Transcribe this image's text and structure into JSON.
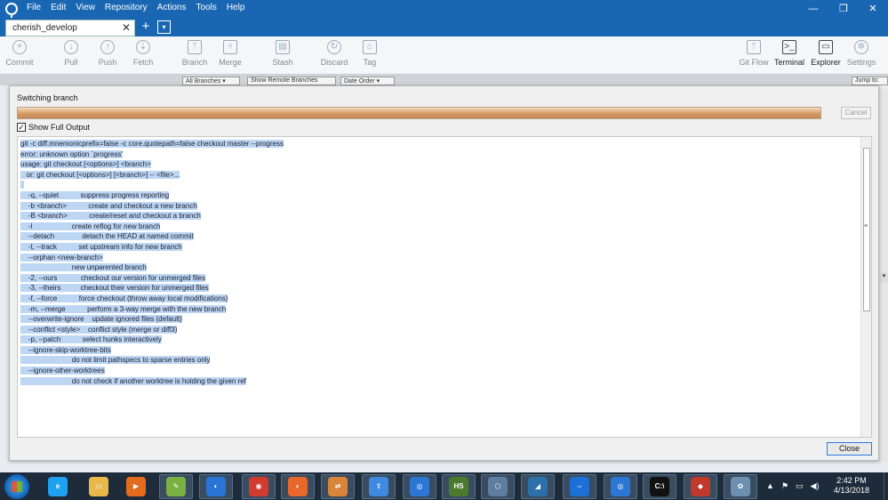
{
  "menu": [
    "File",
    "Edit",
    "View",
    "Repository",
    "Actions",
    "Tools",
    "Help"
  ],
  "window_controls": {
    "minimize": "—",
    "restore": "❐",
    "close": "✕"
  },
  "tab": {
    "label": "cherish_develop",
    "close": "✕",
    "add": "+",
    "dropdown": "▾"
  },
  "toolbar": {
    "commit": "Commit",
    "pull": "Pull",
    "push": "Push",
    "fetch": "Fetch",
    "branch": "Branch",
    "merge": "Merge",
    "stash": "Stash",
    "discard": "Discard",
    "tag": "Tag",
    "gitflow": "Git Flow",
    "terminal": "Terminal",
    "explorer": "Explorer",
    "settings": "Settings"
  },
  "filters": {
    "branches": "All Branches ▾",
    "remote": "Show Remote Branches",
    "order": "Date Order ▾",
    "jump": "Jump to:"
  },
  "dialog": {
    "title": "Switching branch",
    "progress": 1.0,
    "cancel_label": "Cancel",
    "show_output_label": "Show Full Output",
    "show_output_checked": "✓",
    "close_label": "Close",
    "output_lines": [
      "git -c diff.mnemonicprefix=false -c core.quotepath=false checkout master --progress",
      "error: unknown option `progress'",
      "usage: git checkout [<options>] <branch>",
      "   or: git checkout [<options>] [<branch>] -- <file>...",
      "",
      "    -q, --quiet           suppress progress reporting",
      "    -b <branch>           create and checkout a new branch",
      "    -B <branch>           create/reset and checkout a branch",
      "    -l                    create reflog for new branch",
      "    --detach              detach the HEAD at named commit",
      "    -t, --track           set upstream info for new branch",
      "    --orphan <new-branch>",
      "                          new unparented branch",
      "    -2, --ours            checkout our version for unmerged files",
      "    -3, --theirs          checkout their version for unmerged files",
      "    -f, --force           force checkout (throw away local modifications)",
      "    -m, --merge           perform a 3-way merge with the new branch",
      "    --overwrite-ignore    update ignored files (default)",
      "    --conflict <style>    conflict style (merge or diff3)",
      "    -p, --patch           select hunks interactively",
      "    --ignore-skip-worktree-bits",
      "                          do not limit pathspecs to sparse entries only",
      "    --ignore-other-worktrees",
      "                          do not check if another worktree is holding the given ref"
    ]
  },
  "taskbar": {
    "apps": [
      "ie",
      "explorer",
      "media",
      "notepad",
      "firefox-dev",
      "chrome",
      "firefox",
      "remote",
      "up",
      "sourcetree",
      "hs",
      "box",
      "compass",
      "teamviewer",
      "sourcetree2",
      "cmd",
      "git",
      "paint"
    ],
    "tray": {
      "up": "▲",
      "flag": "⚑",
      "net": "▭",
      "vol": "◀)"
    },
    "time": "2:42 PM",
    "date": "4/13/2018"
  }
}
